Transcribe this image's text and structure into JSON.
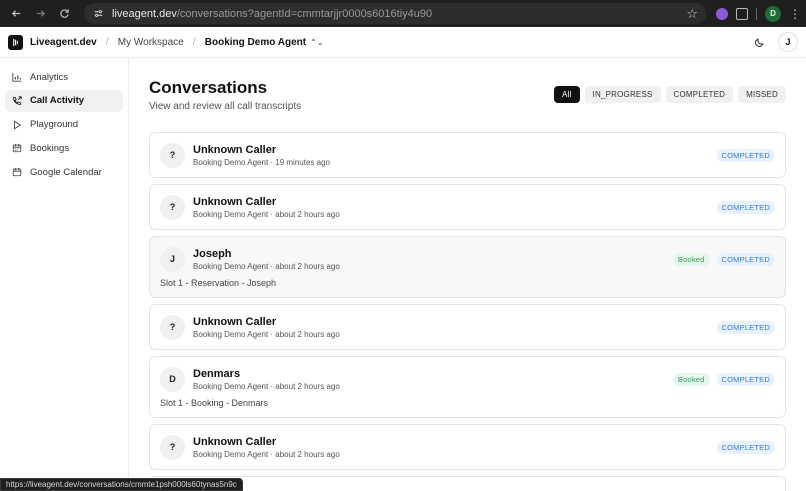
{
  "browser": {
    "url_host": "liveagent.dev",
    "url_path": "/conversations?agentId=cmmtarjjr0000s6016tiy4u90",
    "profile_initial": "D",
    "status_url": "https://liveagent.dev/conversations/cmmte1psh000ls60tynas5n9c"
  },
  "header": {
    "brand": "Liveagent.dev",
    "workspace": "My Workspace",
    "agent": "Booking Demo Agent",
    "user_initial": "J"
  },
  "sidebar": {
    "items": [
      {
        "label": "Analytics",
        "icon": "bar-chart-icon"
      },
      {
        "label": "Call Activity",
        "icon": "phone-icon"
      },
      {
        "label": "Playground",
        "icon": "play-icon"
      },
      {
        "label": "Bookings",
        "icon": "calendar-icon"
      },
      {
        "label": "Google Calendar",
        "icon": "calendar-icon"
      }
    ]
  },
  "main": {
    "title": "Conversations",
    "subtitle": "View and review all call transcripts",
    "filters": [
      "All",
      "IN_PROGRESS",
      "COMPLETED",
      "MISSED"
    ]
  },
  "conversations": [
    {
      "initial": "?",
      "name": "Unknown Caller",
      "meta": "Booking Demo Agent · 19 minutes ago",
      "booked": "",
      "status": "COMPLETED",
      "note": ""
    },
    {
      "initial": "?",
      "name": "Unknown Caller",
      "meta": "Booking Demo Agent · about 2 hours ago",
      "booked": "",
      "status": "COMPLETED",
      "note": ""
    },
    {
      "initial": "J",
      "name": "Joseph",
      "meta": "Booking Demo Agent · about 2 hours ago",
      "booked": "Booked",
      "status": "COMPLETED",
      "note": "Slot 1 - Reservation - Joseph"
    },
    {
      "initial": "?",
      "name": "Unknown Caller",
      "meta": "Booking Demo Agent · about 2 hours ago",
      "booked": "",
      "status": "COMPLETED",
      "note": ""
    },
    {
      "initial": "D",
      "name": "Denmars",
      "meta": "Booking Demo Agent · about 2 hours ago",
      "booked": "Booked",
      "status": "COMPLETED",
      "note": "Slot 1 - Booking - Denmars"
    },
    {
      "initial": "?",
      "name": "Unknown Caller",
      "meta": "Booking Demo Agent · about 2 hours ago",
      "booked": "",
      "status": "COMPLETED",
      "note": ""
    }
  ]
}
